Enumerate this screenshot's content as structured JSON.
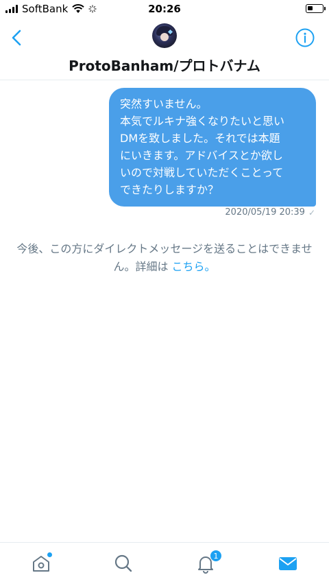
{
  "status_bar": {
    "carrier": "SoftBank",
    "time": "20:26"
  },
  "header": {
    "title": "ProtoBanham/プロトバナム"
  },
  "message": {
    "text": "突然すいません。\n本気でルキナ強くなりたいと思い\nDMを致しました。それでは本題\nにいきます。アドバイスとか欲し\nいので対戦していただくことって\nできたりしますか？",
    "timestamp": "2020/05/19 20:39",
    "status_icon": "✓"
  },
  "notice": {
    "text": "今後、この方にダイレクトメッセージを送ることはできません。詳細は",
    "link": "こちら。"
  },
  "tabs": {
    "notifications_badge": "1"
  },
  "colors": {
    "accent": "#1da1f2",
    "bubble": "#4a9fe9",
    "muted": "#657786"
  }
}
